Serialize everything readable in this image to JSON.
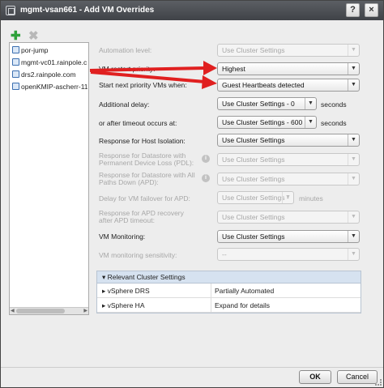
{
  "window": {
    "title": "mgmt-vsan661 - Add VM Overrides",
    "help_glyph": "?",
    "close_glyph": "×"
  },
  "toolbar": {
    "add_glyph": "✚",
    "remove_glyph": "✖"
  },
  "vm_list": [
    {
      "label": "por-jump"
    },
    {
      "label": "mgmt-vc01.rainpole.c"
    },
    {
      "label": "drs2.rainpole.com"
    },
    {
      "label": "openKMIP-ascherr-11"
    }
  ],
  "form": {
    "automation_level": {
      "label": "Automation level:",
      "value": "Use Cluster Settings"
    },
    "restart_priority": {
      "label": "VM restart priority:",
      "value": "Highest"
    },
    "start_next": {
      "label": "Start next priority VMs when:",
      "value": "Guest Heartbeats detected"
    },
    "additional_delay": {
      "label": "Additional delay:",
      "value": "Use Cluster Settings - 0",
      "unit": "seconds"
    },
    "after_timeout": {
      "label": "or after timeout occurs at:",
      "value": "Use Cluster Settings - 600",
      "unit": "seconds"
    },
    "host_isolation": {
      "label": "Response for Host Isolation:",
      "value": "Use Cluster Settings"
    },
    "pdl": {
      "label_1": "Response for Datastore with",
      "label_2": "Permanent Device Loss (PDL):",
      "value": "Use Cluster Settings"
    },
    "apd": {
      "label_1": "Response for Datastore with All",
      "label_2": "Paths Down (APD):",
      "value": "Use Cluster Settings"
    },
    "apd_delay": {
      "label": "Delay for VM failover for APD:",
      "value": "Use Cluster Settings -",
      "unit": "minutes"
    },
    "apd_recovery": {
      "label_1": "Response for APD recovery",
      "label_2": "after APD timeout:",
      "value": "Use Cluster Settings"
    },
    "vm_monitoring": {
      "label": "VM Monitoring:",
      "value": "Use Cluster Settings"
    },
    "monitoring_sensitivity": {
      "label": "VM monitoring sensitivity:",
      "value": "--"
    }
  },
  "cluster_settings": {
    "header": "Relevant Cluster Settings",
    "rows": [
      {
        "name": "vSphere DRS",
        "value": "Partially Automated"
      },
      {
        "name": "vSphere HA",
        "value": "Expand for details"
      }
    ]
  },
  "footer": {
    "ok_label": "OK",
    "cancel_label": "Cancel"
  },
  "colors": {
    "titlebar": "#4a4d52",
    "annotation_arrow": "#e02020",
    "add_icon": "#2ea13a",
    "panel_header": "#d6e2f0"
  },
  "icons": {
    "info": "i",
    "dropdown": "▼",
    "expand": "▸",
    "collapse": "▾"
  }
}
